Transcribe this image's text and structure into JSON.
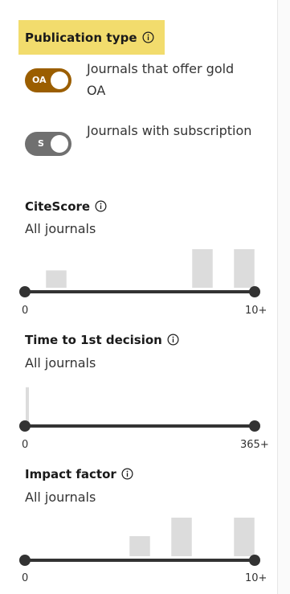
{
  "publication_type": {
    "title": "Publication type",
    "toggles": [
      {
        "badge": "OA",
        "label": "Journals that offer gold OA",
        "state": "on",
        "color": "#9b5e00"
      },
      {
        "badge": "S",
        "label": "Journals with subscription",
        "state": "on",
        "color": "#707070"
      }
    ]
  },
  "filters": [
    {
      "title": "CiteScore",
      "subtitle": "All journals",
      "min_label": "0",
      "max_label": "10+",
      "histogram": [
        0,
        0.45,
        0,
        0,
        0,
        0,
        0,
        0,
        1.0,
        0,
        1.0
      ],
      "range": [
        0,
        1
      ]
    },
    {
      "title": "Time to 1st decision",
      "subtitle": "All journals",
      "min_label": "0",
      "max_label": "365+",
      "histogram": [
        0.9,
        0,
        0,
        0,
        0,
        0,
        0,
        0,
        0,
        0,
        0
      ],
      "range": [
        0,
        1
      ]
    },
    {
      "title": "Impact factor",
      "subtitle": "All journals",
      "min_label": "0",
      "max_label": "10+",
      "histogram": [
        0,
        0,
        0,
        0,
        0,
        0.52,
        0,
        1.0,
        0,
        0,
        1.0
      ],
      "range": [
        0,
        1
      ]
    }
  ],
  "colors": {
    "highlight": "#f2dc6d",
    "slider_track": "#333333",
    "bar": "#dcdcdc"
  }
}
